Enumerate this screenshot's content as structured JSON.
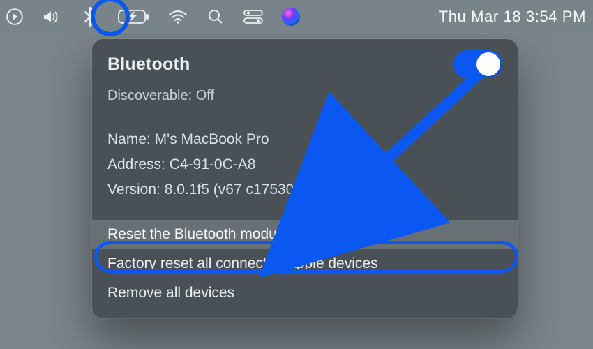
{
  "menubar": {
    "datetime": "Thu Mar 18  3:54 PM"
  },
  "dropdown": {
    "title": "Bluetooth",
    "discoverable_line": "Discoverable: Off",
    "toggle_on": true,
    "info": {
      "name_line": "Name: M's MacBook Pro",
      "address_line": "Address: C4-91-0C-A8",
      "version_line": "Version: 8.0.1f5 (v67 c17530)"
    },
    "actions": {
      "reset_bt": "Reset the Bluetooth module",
      "factory_reset": "Factory reset all connected Apple devices",
      "remove_all": "Remove all devices"
    }
  },
  "annotation": {
    "highlight_color": "#0a57f2"
  }
}
